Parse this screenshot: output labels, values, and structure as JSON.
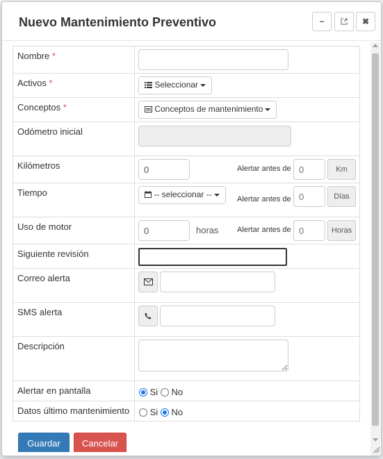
{
  "dialog": {
    "title": "Nuevo Mantenimiento Preventivo",
    "header_buttons": {
      "minimize": "−",
      "close": "✖"
    }
  },
  "form": {
    "nombre": {
      "label": "Nombre",
      "required_mark": "*",
      "value": ""
    },
    "activos": {
      "label": "Activos",
      "required_mark": "*",
      "button_label": "Seleccionar"
    },
    "conceptos": {
      "label": "Conceptos",
      "required_mark": "*",
      "button_label": "Conceptos de mantenimiento"
    },
    "odometro": {
      "label": "Odómetro inicial",
      "value": ""
    },
    "kilometros": {
      "label": "Kilómetros",
      "value": "0",
      "alert_label": "Alertar antes de",
      "alert_placeholder": "0",
      "unit": "Km"
    },
    "tiempo": {
      "label": "Tiempo",
      "select_label": "-- seleccionar --",
      "alert_label": "Alertar antes de",
      "alert_placeholder": "0",
      "unit": "Días"
    },
    "uso_motor": {
      "label": "Uso de motor",
      "value": "0",
      "value_unit": "horas",
      "alert_label": "Alertar antes de",
      "alert_placeholder": "0",
      "unit": "Horas"
    },
    "siguiente_revision": {
      "label": "Siguiente revisión",
      "value": ""
    },
    "correo_alerta": {
      "label": "Correo alerta",
      "value": ""
    },
    "sms_alerta": {
      "label": "SMS alerta",
      "value": ""
    },
    "descripcion": {
      "label": "Descripción",
      "value": ""
    },
    "alertar_pantalla": {
      "label": "Alertar en pantalla",
      "options": [
        "Si",
        "No"
      ],
      "selected": "Si"
    },
    "datos_ultimo": {
      "label": "Datos último mantenimiento",
      "options": [
        "Si",
        "No"
      ],
      "selected": "No"
    }
  },
  "actions": {
    "save": "Guardar",
    "cancel": "Cancelar"
  },
  "icons": {
    "minimize": "minimize-icon",
    "external": "external-link-icon",
    "close": "close-icon",
    "list": "list-icon",
    "card": "card-icon",
    "calendar": "calendar-icon",
    "envelope": "envelope-icon",
    "phone": "phone-icon"
  },
  "colors": {
    "primary": "#337ab7",
    "danger": "#d9534f",
    "required": "#d9534f",
    "radio": "#1a73e8"
  }
}
